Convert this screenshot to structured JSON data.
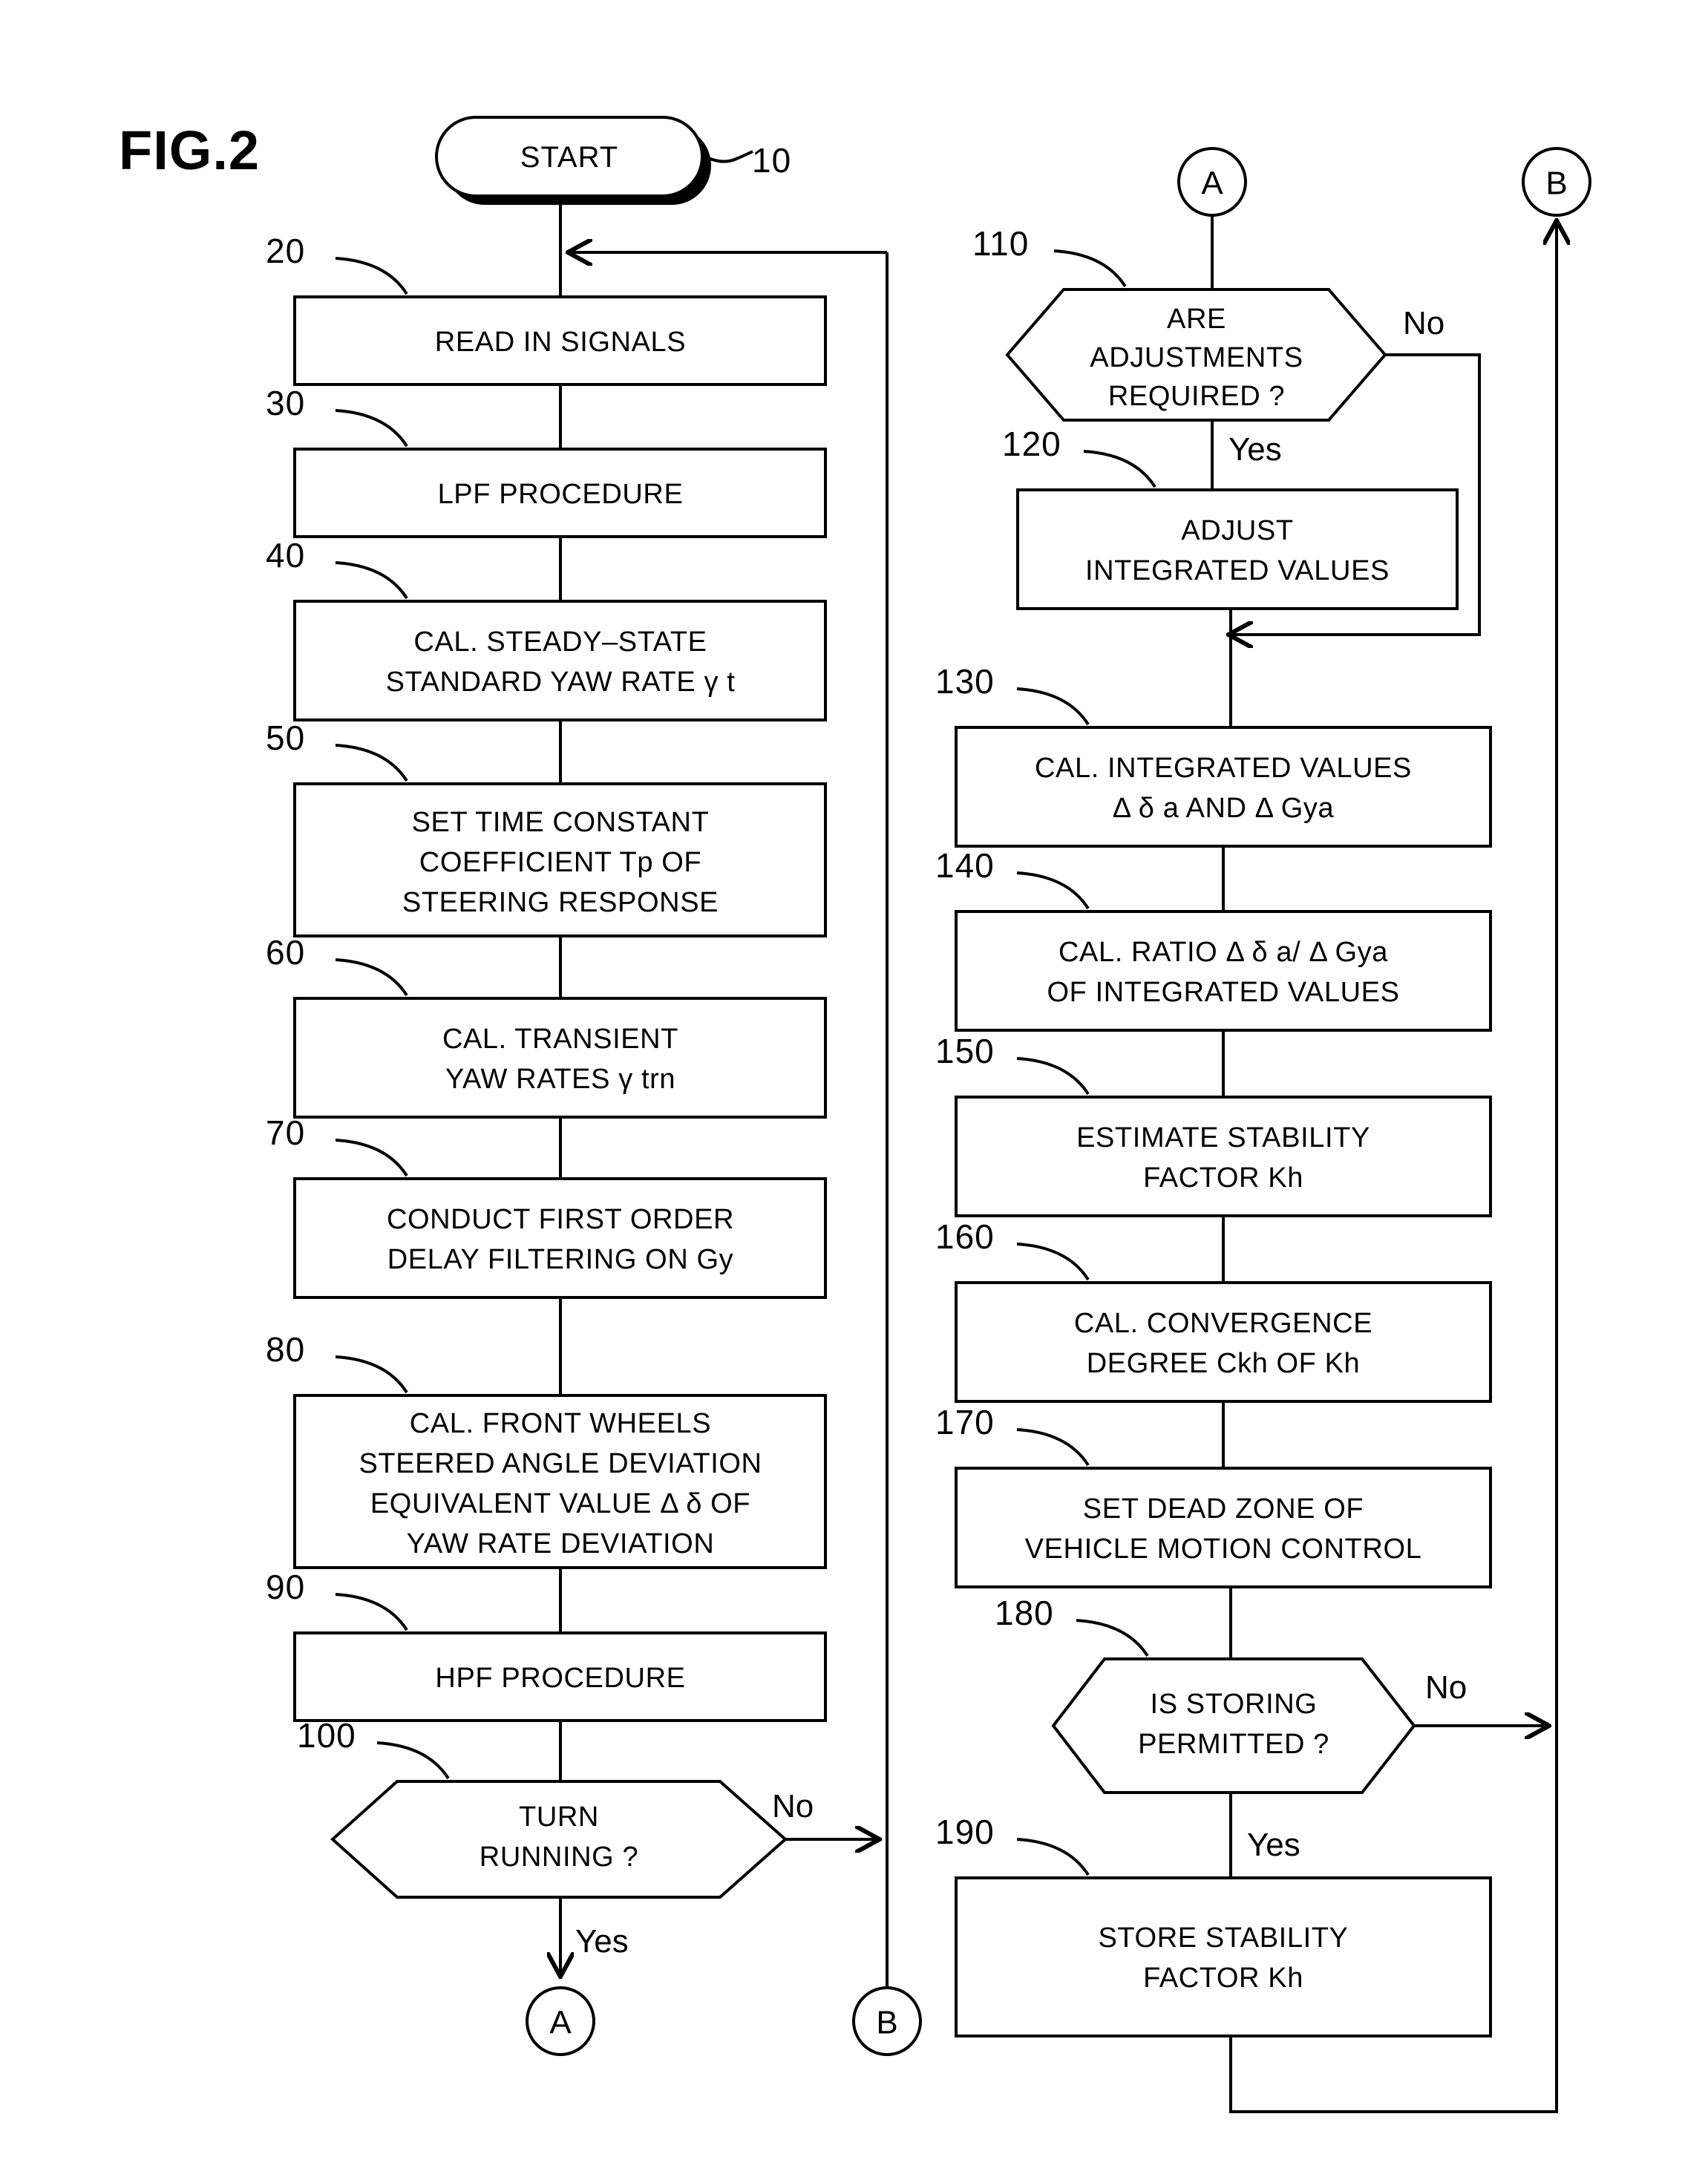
{
  "figure": {
    "label": "FIG.2",
    "start_label": "START",
    "start_ref": "10"
  },
  "connectors": {
    "a_top_right": "A",
    "b_top_right": "B",
    "a_bottom_left": "A",
    "b_bottom_left": "B"
  },
  "branch_labels": {
    "yes": "Yes",
    "no": "No"
  },
  "left_column": [
    {
      "ref": "20",
      "lines": [
        "READ IN SIGNALS"
      ]
    },
    {
      "ref": "30",
      "lines": [
        "LPF PROCEDURE"
      ]
    },
    {
      "ref": "40",
      "lines": [
        "CAL. STEADY–STATE",
        "STANDARD YAW RATE γ t"
      ]
    },
    {
      "ref": "50",
      "lines": [
        "SET TIME CONSTANT",
        "COEFFICIENT Tp OF",
        "STEERING RESPONSE"
      ]
    },
    {
      "ref": "60",
      "lines": [
        "CAL. TRANSIENT",
        "YAW RATES  γ trn"
      ]
    },
    {
      "ref": "70",
      "lines": [
        "CONDUCT FIRST ORDER",
        "DELAY FILTERING ON Gy"
      ]
    },
    {
      "ref": "80",
      "lines": [
        "CAL. FRONT WHEELS",
        "STEERED ANGLE DEVIATION",
        "EQUIVALENT VALUE Δ δ OF",
        "YAW RATE DEVIATION"
      ]
    },
    {
      "ref": "90",
      "lines": [
        "HPF PROCEDURE"
      ]
    }
  ],
  "left_decision": {
    "ref": "100",
    "lines": [
      "TURN",
      "RUNNING ?"
    ],
    "yes": "Yes",
    "no": "No"
  },
  "right_decision_top": {
    "ref": "110",
    "lines": [
      "ARE",
      "ADJUSTMENTS",
      "REQUIRED ?"
    ],
    "yes": "Yes",
    "no": "No"
  },
  "right_column": [
    {
      "ref": "120",
      "lines": [
        "ADJUST",
        "INTEGRATED VALUES"
      ]
    },
    {
      "ref": "130",
      "lines": [
        "CAL. INTEGRATED VALUES",
        "Δ δ a AND  Δ Gya"
      ]
    },
    {
      "ref": "140",
      "lines": [
        "CAL.  RATIO Δ δ a/ Δ Gya",
        "OF INTEGRATED VALUES"
      ]
    },
    {
      "ref": "150",
      "lines": [
        "ESTIMATE STABILITY",
        "FACTOR Kh"
      ]
    },
    {
      "ref": "160",
      "lines": [
        "CAL. CONVERGENCE",
        "DEGREE Ckh OF Kh"
      ]
    },
    {
      "ref": "170",
      "lines": [
        "SET DEAD ZONE OF",
        "VEHICLE MOTION CONTROL"
      ]
    }
  ],
  "right_decision_bottom": {
    "ref": "180",
    "lines": [
      "IS STORING",
      "PERMITTED ?"
    ],
    "yes": "Yes",
    "no": "No"
  },
  "right_column_last": [
    {
      "ref": "190",
      "lines": [
        "STORE  STABILITY",
        "FACTOR Kh"
      ]
    }
  ],
  "colors": {
    "stroke": "#000000",
    "fill": "#ffffff"
  }
}
